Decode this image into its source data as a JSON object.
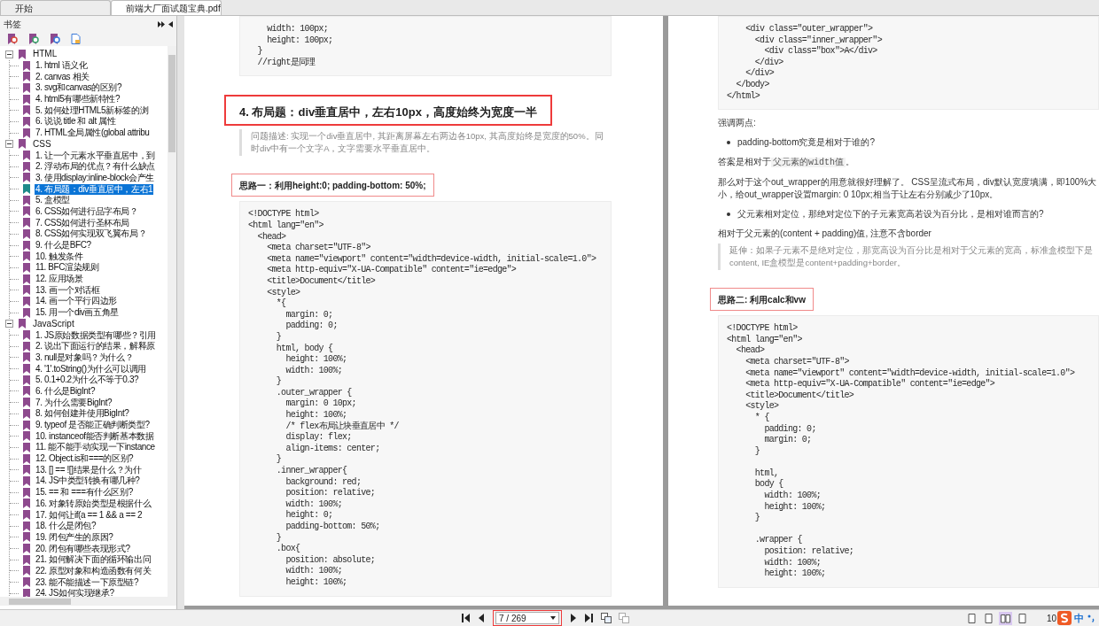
{
  "tabs": [
    {
      "label": "开始",
      "selected": false,
      "closable": false
    },
    {
      "label": "前端大厂面试题宝典.pdf",
      "selected": true,
      "closable": true
    }
  ],
  "sidebar": {
    "title": "书签",
    "tree": [
      {
        "label": "HTML",
        "expanded": true,
        "selected": false,
        "children": [
          {
            "label": "1. html 语义化",
            "selected": false
          },
          {
            "label": "2. canvas 相关",
            "selected": false
          },
          {
            "label": "3. svg和canvas的区别?",
            "selected": false
          },
          {
            "label": "4. html5有哪些新特性?",
            "selected": false
          },
          {
            "label": "5. 如何处理HTML5新标签的浏",
            "selected": false
          },
          {
            "label": "6. 说说 title 和 alt 属性",
            "selected": false
          },
          {
            "label": "7. HTML全局属性(global attribu",
            "selected": false
          }
        ]
      },
      {
        "label": "CSS",
        "expanded": true,
        "selected": false,
        "children": [
          {
            "label": "1. 让一个元素水平垂直居中，到",
            "selected": false
          },
          {
            "label": "2. 浮动布局的优点？有什么缺点",
            "selected": false
          },
          {
            "label": "3. 使用display:inline-block会产生",
            "selected": false
          },
          {
            "label": "4. 布局题：div垂直居中，左右1",
            "selected": true
          },
          {
            "label": "5. 盒模型",
            "selected": false
          },
          {
            "label": "6. CSS如何进行品字布局？",
            "selected": false
          },
          {
            "label": "7. CSS如何进行圣杯布局",
            "selected": false
          },
          {
            "label": "8. CSS如何实现双飞翼布局？",
            "selected": false
          },
          {
            "label": "9. 什么是BFC?",
            "selected": false
          },
          {
            "label": "10. 触发条件",
            "selected": false
          },
          {
            "label": "11. BFC渲染规则",
            "selected": false
          },
          {
            "label": "12. 应用场景",
            "selected": false
          },
          {
            "label": "13. 画一个对话框",
            "selected": false
          },
          {
            "label": "14. 画一个平行四边形",
            "selected": false
          },
          {
            "label": "15. 用一个div画五角星",
            "selected": false
          }
        ]
      },
      {
        "label": "JavaScript",
        "expanded": true,
        "selected": false,
        "children": [
          {
            "label": "1. JS原始数据类型有哪些？引用",
            "selected": false
          },
          {
            "label": "2. 说出下面运行的结果，解释原",
            "selected": false
          },
          {
            "label": "3. null是对象吗？为什么？",
            "selected": false
          },
          {
            "label": "4. '1'.toString()为什么可以调用",
            "selected": false
          },
          {
            "label": "5. 0.1+0.2为什么不等于0.3?",
            "selected": false
          },
          {
            "label": "6. 什么是BigInt?",
            "selected": false
          },
          {
            "label": "7. 为什么需要BigInt?",
            "selected": false
          },
          {
            "label": "8. 如何创建并使用BigInt?",
            "selected": false
          },
          {
            "label": "9. typeof 是否能正确判断类型?",
            "selected": false
          },
          {
            "label": "10. instanceof能否判断基本数据",
            "selected": false
          },
          {
            "label": "11. 能不能手动实现一下instance",
            "selected": false
          },
          {
            "label": "12. Object.is和===的区别?",
            "selected": false
          },
          {
            "label": "13. [] == ![]结果是什么？为什",
            "selected": false
          },
          {
            "label": "14. JS中类型转换有哪几种?",
            "selected": false
          },
          {
            "label": "15. == 和 ===有什么区别?",
            "selected": false
          },
          {
            "label": "16. 对象转原始类型是根据什么",
            "selected": false
          },
          {
            "label": "17. 如何让if(a == 1 && a == 2",
            "selected": false
          },
          {
            "label": "18. 什么是闭包?",
            "selected": false
          },
          {
            "label": "19. 闭包产生的原因?",
            "selected": false
          },
          {
            "label": "20. 闭包有哪些表现形式?",
            "selected": false
          },
          {
            "label": "21. 如何解决下面的循环输出问",
            "selected": false
          },
          {
            "label": "22. 原型对象和构造函数有何关",
            "selected": false
          },
          {
            "label": "23. 能不能描述一下原型链?",
            "selected": false
          },
          {
            "label": "24. JS如何实现继承?",
            "selected": false
          }
        ]
      }
    ]
  },
  "pages": [
    {
      "blocks": [
        {
          "kind": "code",
          "code": "    width: 100px;\n    height: 100px;\n  }\n  //right是同理"
        },
        {
          "kind": "heading",
          "text": "4. 布局题：div垂直居中，左右10px，高度始终为宽度一半"
        },
        {
          "kind": "quote",
          "text": "问题描述: 实现一个div垂直居中, 其距离屏幕左右两边各10px, 其高度始终是宽度的50%。同时div中有一个文字A，文字需要水平垂直居中。"
        },
        {
          "kind": "label",
          "text": "思路一：利用height:0; padding-bottom: 50%;"
        },
        {
          "kind": "code",
          "code": "<!DOCTYPE html>\n<html lang=\"en\">\n  <head>\n    <meta charset=\"UTF-8\">\n    <meta name=\"viewport\" content=\"width=device-width, initial-scale=1.0\">\n    <meta http-equiv=\"X-UA-Compatible\" content=\"ie=edge\">\n    <title>Document</title>\n    <style>\n      *{\n        margin: 0;\n        padding: 0;\n      }\n      html, body {\n        height: 100%;\n        width: 100%;\n      }\n      .outer_wrapper {\n        margin: 0 10px;\n        height: 100%;\n        /* flex布局让块垂直居中 */\n        display: flex;\n        align-items: center;\n      }\n      .inner_wrapper{\n        background: red;\n        position: relative;\n        width: 100%;\n        height: 0;\n        padding-bottom: 50%;\n      }\n      .box{\n        position: absolute;\n        width: 100%;\n        height: 100%;"
        }
      ]
    },
    {
      "blocks": [
        {
          "kind": "code",
          "code": "    <div class=\"outer_wrapper\">\n      <div class=\"inner_wrapper\">\n        <div class=\"box\">A</div>\n      </div>\n    </div>\n  </body>\n</html>"
        },
        {
          "kind": "para",
          "text": "强调两点:"
        },
        {
          "kind": "bullet",
          "text": "padding-bottom究竟是相对于谁的?"
        },
        {
          "kind": "para_code",
          "parts": [
            {
              "kind": "text",
              "text": "答案是相对于"
            },
            {
              "kind": "code",
              "text": "父元素的width值"
            },
            {
              "kind": "text",
              "text": "。"
            }
          ]
        },
        {
          "kind": "para",
          "text": "那么对于这个out_wrapper的用意就很好理解了。 CSS呈流式布局，div默认宽度填满，即100%大小，给out_wrapper设置margin: 0 10px;相当于让左右分别减少了10px。"
        },
        {
          "kind": "bullet",
          "text": "父元素相对定位，那绝对定位下的子元素宽高若设为百分比，是相对谁而言的?"
        },
        {
          "kind": "para",
          "text": "相对于父元素的(content + padding)值, 注意不含border"
        },
        {
          "kind": "quote",
          "text": "延伸：如果子元素不是绝对定位，那宽高设为百分比是相对于父元素的宽高，标准盒模型下是content, IE盒模型是content+padding+border。"
        },
        {
          "kind": "label",
          "text": "思路二: 利用calc和vw"
        },
        {
          "kind": "code",
          "code": "<!DOCTYPE html>\n<html lang=\"en\">\n  <head>\n    <meta charset=\"UTF-8\">\n    <meta name=\"viewport\" content=\"width=device-width, initial-scale=1.0\">\n    <meta http-equiv=\"X-UA-Compatible\" content=\"ie=edge\">\n    <title>Document</title>\n    <style>\n      * {\n        padding: 0;\n        margin: 0;\n      }\n\n      html,\n      body {\n        width: 100%;\n        height: 100%;\n      }\n\n      .wrapper {\n        position: relative;\n        width: 100%;\n        height: 100%;"
        }
      ]
    }
  ],
  "status_bar": {
    "page_field": "7 / 269",
    "view_modes": [
      {
        "selected": false
      },
      {
        "selected": false
      },
      {
        "selected": true
      },
      {
        "selected": false
      }
    ],
    "zoom": "10",
    "ime": "中"
  }
}
